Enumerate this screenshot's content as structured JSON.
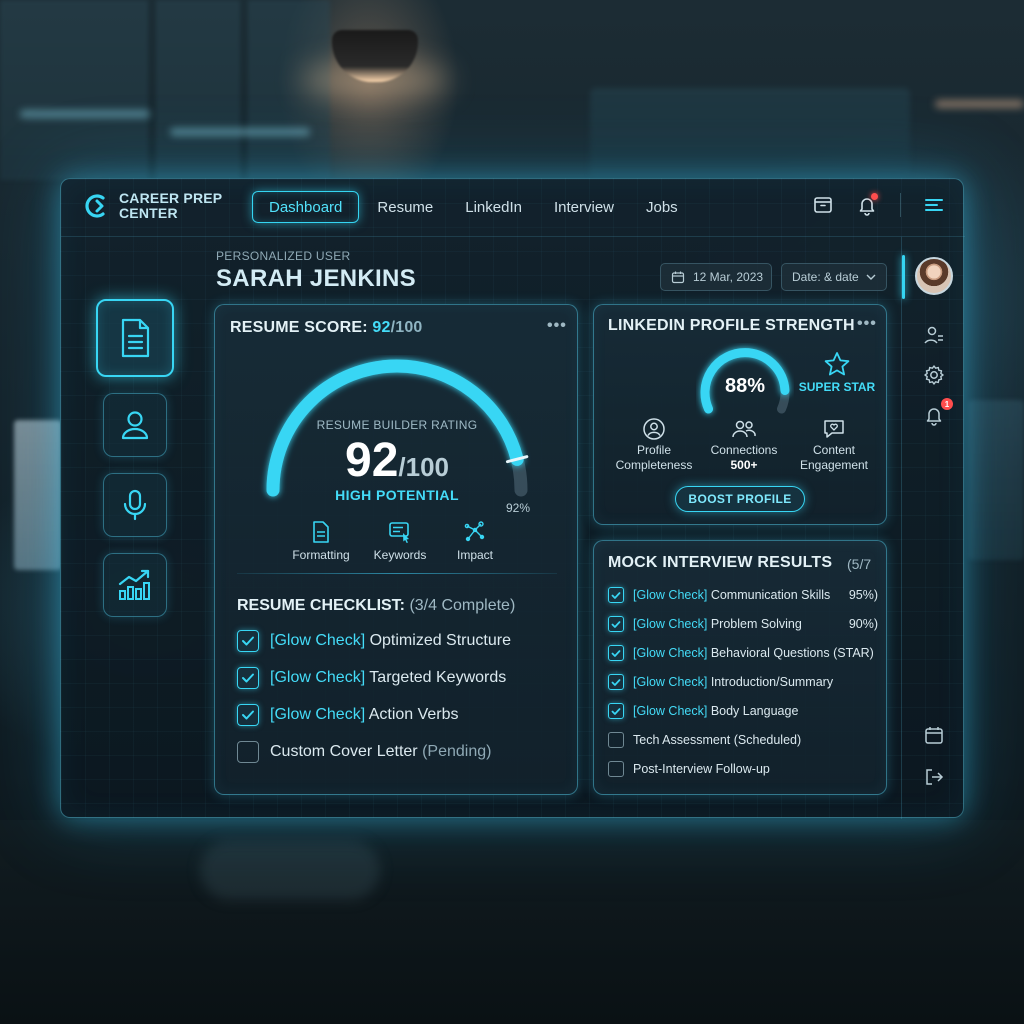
{
  "brand": {
    "line1": "CAREER PREP",
    "line2": "CENTER"
  },
  "nav": [
    {
      "label": "Dashboard",
      "active": true
    },
    {
      "label": "Resume",
      "active": false
    },
    {
      "label": "LinkedIn",
      "active": false
    },
    {
      "label": "Interview",
      "active": false
    },
    {
      "label": "Jobs",
      "active": false
    }
  ],
  "header": {
    "subtitle": "PERSONALIZED USER",
    "name": "SARAH JENKINS",
    "date": "12 Mar, 2023",
    "date_select": "Date: & date"
  },
  "right_sidebar": {
    "notification_count": "1"
  },
  "resume": {
    "title_prefix": "RESUME SCORE: ",
    "score": "92",
    "score_max": "/100",
    "gauge_label": "RESUME BUILDER RATING",
    "gauge_value": "92",
    "gauge_max": "/100",
    "gauge_fraction": 0.92,
    "potential": "HIGH POTENTIAL",
    "percent": "92%",
    "metrics": [
      "Formatting",
      "Keywords",
      "Impact"
    ],
    "checklist_title": "RESUME CHECKLIST: ",
    "checklist_progress": "(3/4 Complete)",
    "checklist": [
      {
        "tag": "[Glow Check]",
        "label": " Optimized Structure",
        "checked": true
      },
      {
        "tag": "[Glow Check]",
        "label": " Targeted Keywords",
        "checked": true
      },
      {
        "tag": "[Glow Check]",
        "label": " Action Verbs",
        "checked": true
      },
      {
        "tag": "",
        "label": "Custom Cover Letter ",
        "note": "(Pending)",
        "checked": false
      }
    ]
  },
  "linkedin": {
    "title": "LINKEDIN PROFILE STRENGTH",
    "strength": "88%",
    "strength_fraction": 0.88,
    "badge": "SUPER STAR",
    "items": [
      {
        "line1": "Profile",
        "line2": "Completeness"
      },
      {
        "line1": "Connections",
        "line2": "500+"
      },
      {
        "line1": "Content",
        "line2": "Engagement"
      }
    ],
    "cta": "BOOST PROFILE"
  },
  "mock": {
    "title": "MOCK INTERVIEW RESULTS",
    "count": "(5/7",
    "rows": [
      {
        "tag": "[Glow Check]",
        "label": " Communication Skills",
        "pct": "95%)",
        "checked": true
      },
      {
        "tag": "[Glow Check]",
        "label": " Problem Solving",
        "pct": "90%)",
        "checked": true
      },
      {
        "tag": "[Glow Check]",
        "label": " Behavioral Questions (STAR)",
        "pct": "",
        "checked": true
      },
      {
        "tag": "[Glow Check]",
        "label": " Introduction/Summary",
        "pct": "",
        "checked": true
      },
      {
        "tag": "[Glow Check]",
        "label": " Body Language",
        "pct": "",
        "checked": true
      },
      {
        "tag": "",
        "label": "Tech Assessment (Scheduled)",
        "pct": "",
        "checked": false
      },
      {
        "tag": "",
        "label": "Post-Interview Follow-up",
        "pct": "",
        "checked": false
      }
    ]
  },
  "colors": {
    "accent": "#38d6f4",
    "alert": "#ff4d4d",
    "panel": "#12222c"
  }
}
